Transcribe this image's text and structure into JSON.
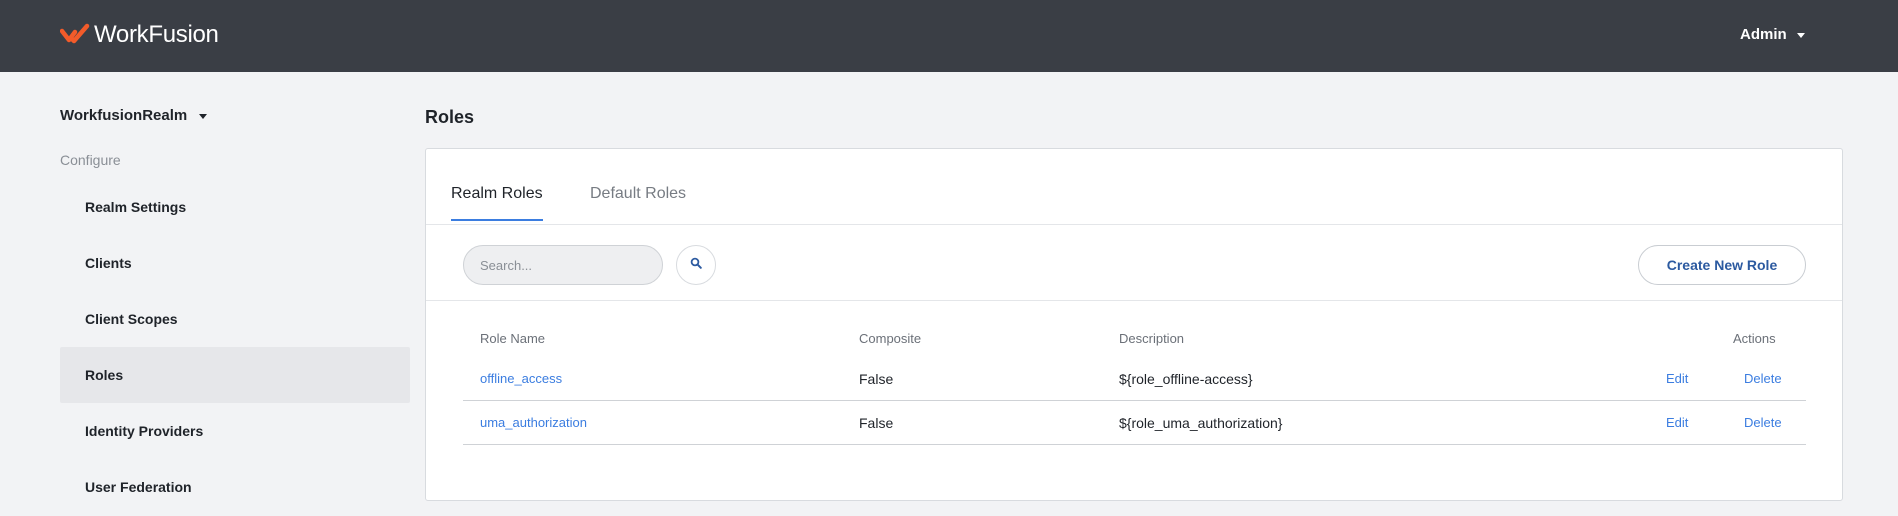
{
  "header": {
    "brand": "WorkFusion",
    "user_menu_label": "Admin",
    "colors": {
      "bar": "#3a3e45",
      "logo_mark": "#f25b2a"
    },
    "icons": {
      "logo": "workfusion-logo-icon",
      "user_caret": "caret-down-icon"
    }
  },
  "sidebar": {
    "realm_label": "WorkfusionRealm",
    "section_label": "Configure",
    "items": [
      {
        "label": "Realm Settings",
        "active": false
      },
      {
        "label": "Clients",
        "active": false
      },
      {
        "label": "Client Scopes",
        "active": false
      },
      {
        "label": "Roles",
        "active": true
      },
      {
        "label": "Identity Providers",
        "active": false
      },
      {
        "label": "User Federation",
        "active": false
      }
    ]
  },
  "main": {
    "title": "Roles",
    "tabs": [
      {
        "label": "Realm Roles",
        "active": true
      },
      {
        "label": "Default Roles",
        "active": false
      }
    ],
    "search": {
      "placeholder": "Search...",
      "value": ""
    },
    "create_button_label": "Create New Role",
    "table": {
      "columns": [
        "Role Name",
        "Composite",
        "Description",
        "Actions"
      ],
      "rows": [
        {
          "name": "offline_access",
          "composite": "False",
          "description": "${role_offline-access}",
          "edit": "Edit",
          "delete": "Delete"
        },
        {
          "name": "uma_authorization",
          "composite": "False",
          "description": "${role_uma_authorization}",
          "edit": "Edit",
          "delete": "Delete"
        }
      ]
    },
    "colors": {
      "accent": "#3b7de0",
      "button_text": "#2c5aa0"
    }
  }
}
